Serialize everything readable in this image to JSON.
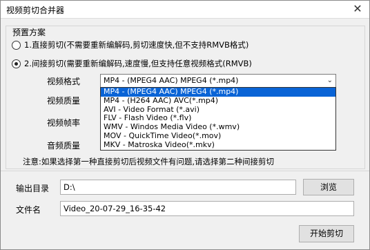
{
  "window": {
    "title": "视频剪切合并器",
    "close_glyph": "✕"
  },
  "preset": {
    "group_label": "预置方案",
    "option1": {
      "label": "1.直接剪切(不需要重新编解码,剪切速度快,但不支持RMVB格式)",
      "checked": false
    },
    "option2": {
      "label": "2.间接剪切(需要重新编解码,速度慢,但支持任意视频格式(RMVB)",
      "checked": true
    }
  },
  "fields": {
    "video_format_label": "视频格式",
    "video_quality_label": "视频质量",
    "video_framerate_label": "视频帧率",
    "audio_quality_label": "音频质量"
  },
  "format_select": {
    "selected": "MP4 - (MPEG4 AAC) MPEG4 (*.mp4)",
    "chevron_icon": "chevron-down-icon",
    "options": [
      "MP4 - (MPEG4 AAC) MPEG4 (*.mp4)",
      "MP4 - (H264 AAC) AVC(*.mp4)",
      "AVI - Video Format (*.avi)",
      "FLV - Flash Video (*.flv)",
      "WMV - Windos Media Video (*.wmv)",
      "MOV - QuickTime Video(*.mov)",
      "MKV - Matroska Video(*.mkv)"
    ]
  },
  "note": "注意:如果选择第一种直接剪切后视频文件有问题,请选择第二种间接剪切",
  "output": {
    "dir_label": "输出目录",
    "dir_value": "D:\\",
    "browse_button": "浏览",
    "filename_label": "文件名",
    "filename_value": "Video_20-07-29_16-35-42"
  },
  "start_button": "开始剪切",
  "colors": {
    "selection": "#0a64d6",
    "background": "#f0f0f0"
  }
}
